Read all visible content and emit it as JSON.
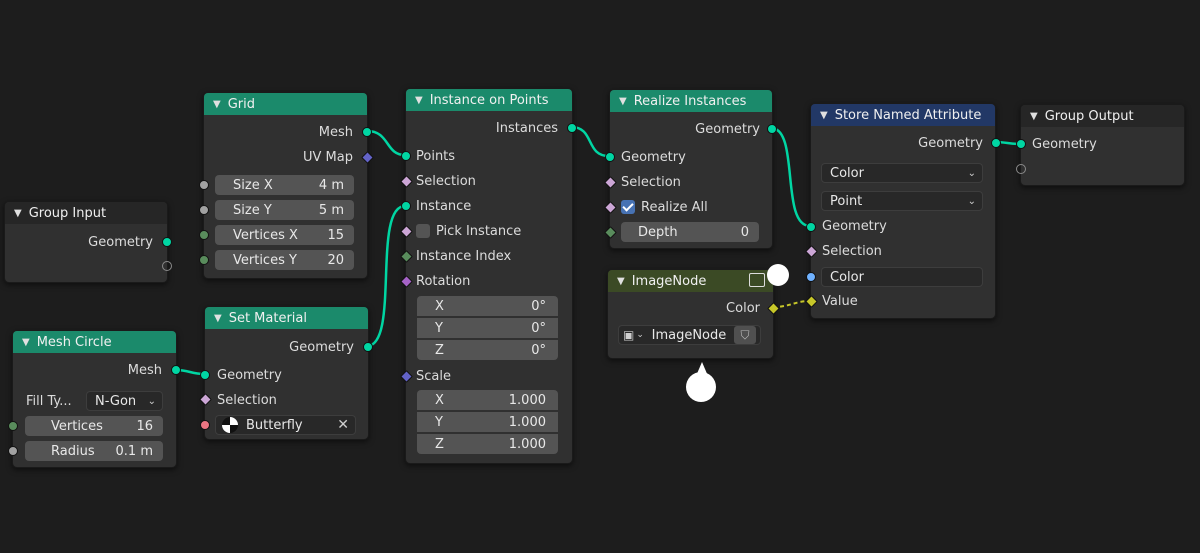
{
  "nodes": {
    "group_input": {
      "title": "Group Input",
      "out_geometry": "Geometry"
    },
    "grid": {
      "title": "Grid",
      "out_mesh": "Mesh",
      "out_uvmap": "UV Map",
      "size_x_label": "Size X",
      "size_x_value": "4 m",
      "size_y_label": "Size Y",
      "size_y_value": "5 m",
      "vert_x_label": "Vertices X",
      "vert_x_value": "15",
      "vert_y_label": "Vertices Y",
      "vert_y_value": "20"
    },
    "mesh_circle": {
      "title": "Mesh Circle",
      "out_mesh": "Mesh",
      "fill_label": "Fill Ty...",
      "fill_value": "N-Gon",
      "vertices_label": "Vertices",
      "vertices_value": "16",
      "radius_label": "Radius",
      "radius_value": "0.1 m"
    },
    "set_material": {
      "title": "Set Material",
      "out_geometry": "Geometry",
      "in_geometry": "Geometry",
      "in_selection": "Selection",
      "material_value": "Butterfly"
    },
    "instance_on_points": {
      "title": "Instance on Points",
      "out_instances": "Instances",
      "in_points": "Points",
      "in_selection": "Selection",
      "in_instance": "Instance",
      "pick_instance": "Pick Instance",
      "instance_index": "Instance Index",
      "rotation": "Rotation",
      "rot_x_label": "X",
      "rot_x_value": "0°",
      "rot_y_label": "Y",
      "rot_y_value": "0°",
      "rot_z_label": "Z",
      "rot_z_value": "0°",
      "scale": "Scale",
      "scale_x_label": "X",
      "scale_x_value": "1.000",
      "scale_y_label": "Y",
      "scale_y_value": "1.000",
      "scale_z_label": "Z",
      "scale_z_value": "1.000"
    },
    "realize_instances": {
      "title": "Realize Instances",
      "out_geometry": "Geometry",
      "in_geometry": "Geometry",
      "in_selection": "Selection",
      "realize_all": "Realize All",
      "depth_label": "Depth",
      "depth_value": "0"
    },
    "image_node": {
      "title": "ImageNode",
      "out_color": "Color",
      "image_value": "ImageNode"
    },
    "store_named_attribute": {
      "title": "Store Named Attribute",
      "out_geometry": "Geometry",
      "type_value": "Color",
      "domain_value": "Point",
      "in_geometry": "Geometry",
      "in_selection": "Selection",
      "name_value": "Color",
      "in_value": "Value"
    },
    "group_output": {
      "title": "Group Output",
      "in_geometry": "Geometry"
    }
  },
  "colors": {
    "background": "#1d1d1d",
    "geometry_header": "#1b8a6b",
    "texture_header": "#3b4a25",
    "attribute_header": "#223866",
    "geometry_socket": "#00d6a3",
    "color_socket": "#c7c729"
  }
}
